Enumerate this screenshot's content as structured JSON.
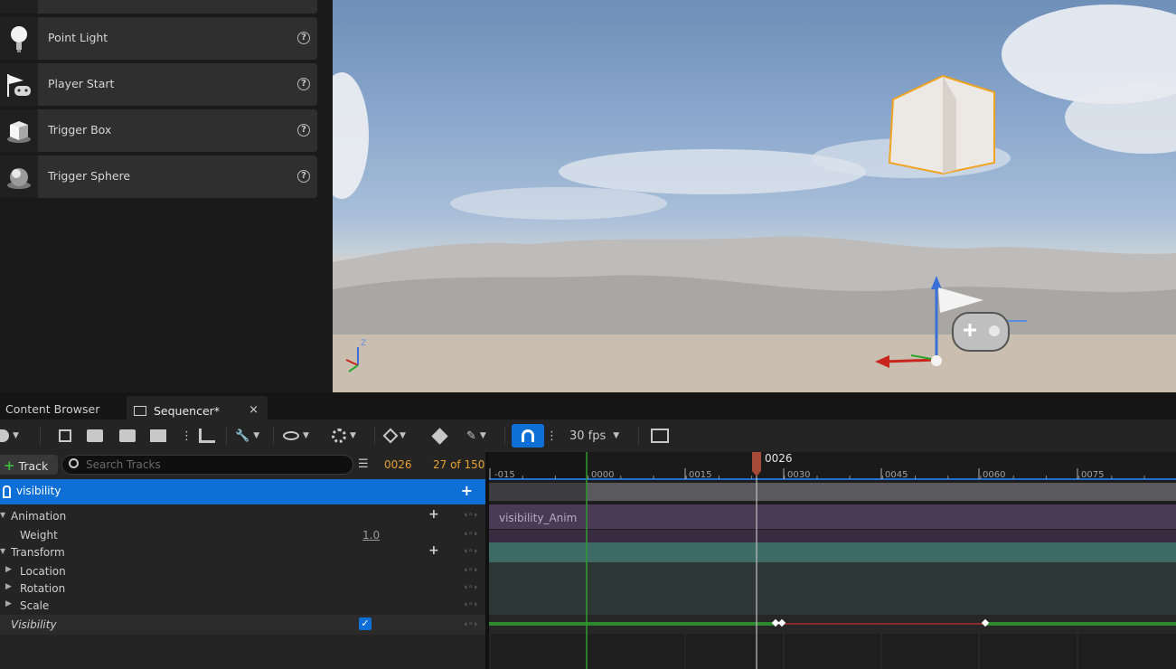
{
  "place_actors": {
    "items": [
      {
        "label": "Point Light",
        "icon": "point-light-icon"
      },
      {
        "label": "Player Start",
        "icon": "player-start-icon"
      },
      {
        "label": "Trigger Box",
        "icon": "trigger-box-icon"
      },
      {
        "label": "Trigger Sphere",
        "icon": "trigger-sphere-icon"
      }
    ],
    "help_glyph": "?"
  },
  "viewport": {
    "axis_z_label": "Z"
  },
  "tabs": [
    {
      "label": "Content Browser"
    },
    {
      "label": "Sequencer*"
    }
  ],
  "tab_close": "×",
  "toolbar": {
    "fps_label": "30 fps"
  },
  "sequencer": {
    "add_track_label": "Track",
    "search_placeholder": "Search Tracks",
    "current_frame": "0026",
    "frame_count": "27 of 150",
    "playhead_label": "0026",
    "ruler_labels": [
      "-015",
      "0000",
      "0015",
      "0030",
      "0045",
      "0060",
      "0075"
    ],
    "tracks": {
      "root": "visibility",
      "animation": "Animation",
      "weight": "Weight",
      "weight_value": "1.0",
      "transform": "Transform",
      "location": "Location",
      "rotation": "Rotation",
      "scale": "Scale",
      "visibility": "Visibility",
      "visibility_checked": true
    },
    "anim_section_label": "visibility_Anim"
  },
  "colors": {
    "accent": "#0e6fd6",
    "anim_section": "#4a3a56",
    "transform_section": "#3f6b66",
    "vis_on": "#2e8a2e",
    "vis_off": "#8a2a2a",
    "playhead": "#a84a3a",
    "frame_text": "#e8a030"
  }
}
